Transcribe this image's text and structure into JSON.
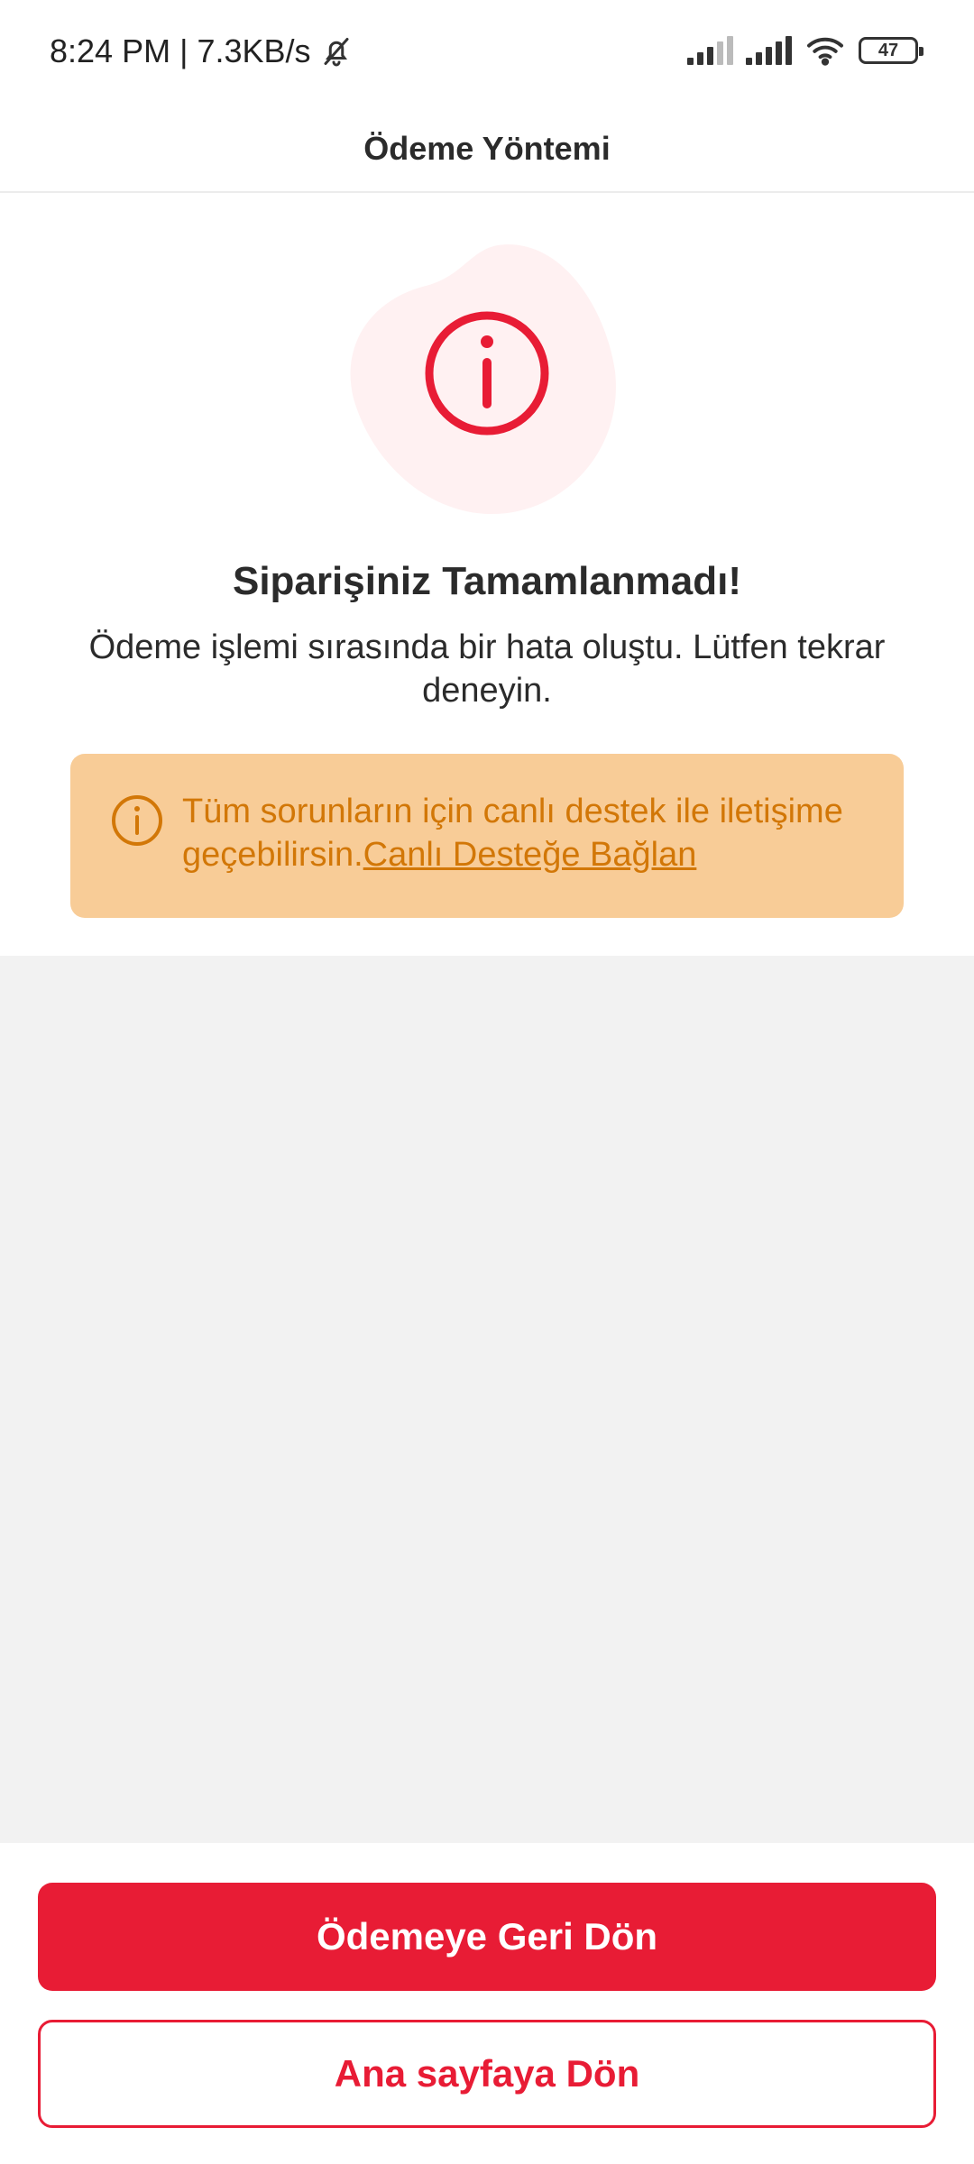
{
  "status_bar": {
    "time": "8:24 PM",
    "separator": "|",
    "network_speed": "7.3KB/s",
    "battery_level": "47"
  },
  "header": {
    "title": "Ödeme Yöntemi"
  },
  "result": {
    "icon": "info-circle-icon",
    "icon_color": "#e81c35",
    "blob_color": "#fff1f2",
    "title": "Siparişiniz Tamamlanmadı!",
    "description": "Ödeme işlemi sırasında bir hata oluştu. Lütfen tekrar deneyin."
  },
  "notice": {
    "icon": "info-circle-icon",
    "text": "Tüm sorunların için canlı destek ile iletişime geçebilirsin.",
    "link_label": "Canlı Desteğe Bağlan",
    "background": "#f8cc97",
    "text_color": "#d27707"
  },
  "actions": {
    "primary_label": "Ödemeye Geri Dön",
    "secondary_label": "Ana sayfaya Dön",
    "accent": "#e81c35"
  }
}
